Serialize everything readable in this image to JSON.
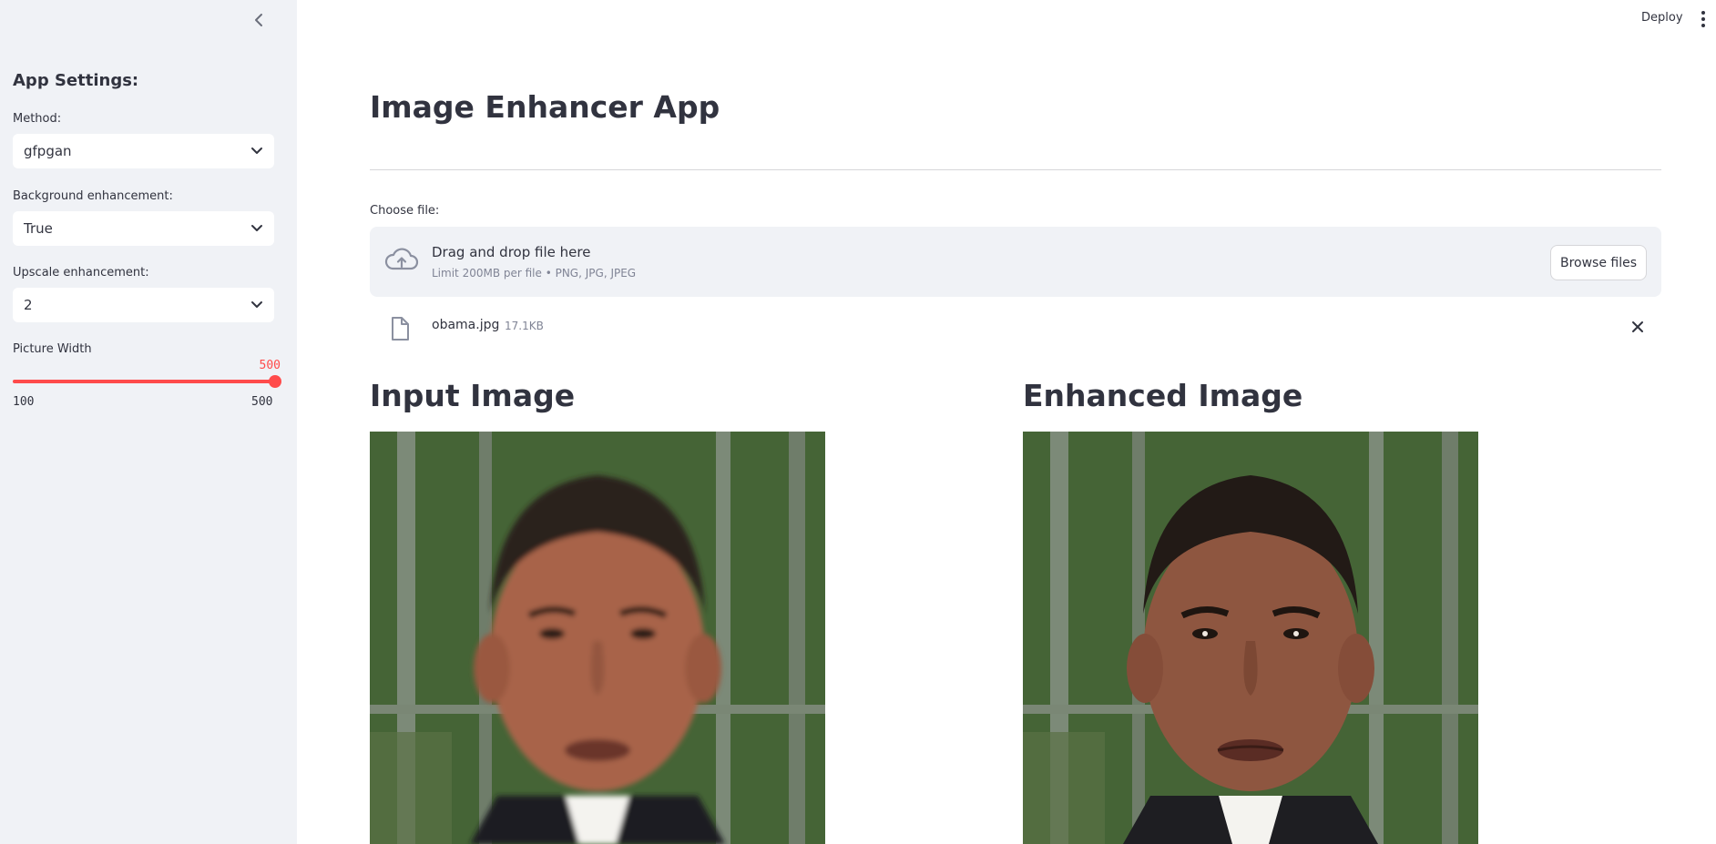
{
  "sidebar": {
    "title": "App Settings:",
    "method": {
      "label": "Method:",
      "value": "gfpgan"
    },
    "background": {
      "label": "Background enhancement:",
      "value": "True"
    },
    "upscale": {
      "label": "Upscale enhancement:",
      "value": "2"
    },
    "width_slider": {
      "label": "Picture Width",
      "value": 500,
      "value_text": "500",
      "min": "100",
      "max": "500",
      "fraction": 1.0
    }
  },
  "header": {
    "deploy_label": "Deploy"
  },
  "main": {
    "title": "Image Enhancer App",
    "uploader": {
      "label": "Choose file:",
      "drop_text": "Drag and drop file here",
      "limit_text": "Limit 200MB per file • PNG, JPG, JPEG",
      "browse_label": "Browse files"
    },
    "file": {
      "name": "obama.jpg",
      "size": "17.1KB"
    },
    "input_title": "Input Image",
    "output_title": "Enhanced Image"
  },
  "colors": {
    "accent": "#ff4b4b",
    "sidebar_bg": "#f0f2f6",
    "text": "#31333f"
  },
  "icons": [
    "chevron-left-icon",
    "chevron-down-icon",
    "cloud-upload-icon",
    "file-icon",
    "close-icon",
    "more-vertical-icon"
  ]
}
